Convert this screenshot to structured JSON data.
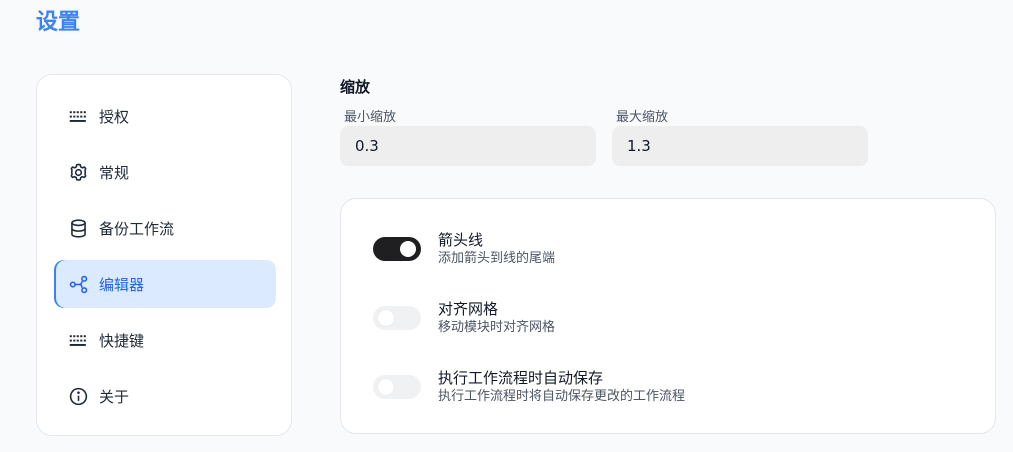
{
  "page": {
    "title": "设置"
  },
  "sidebar": {
    "items": [
      {
        "label": "授权",
        "icon": "keyboard-icon",
        "active": false
      },
      {
        "label": "常规",
        "icon": "gear-icon",
        "active": false
      },
      {
        "label": "备份工作流",
        "icon": "database-icon",
        "active": false
      },
      {
        "label": "编辑器",
        "icon": "share-nodes-icon",
        "active": true
      },
      {
        "label": "快捷键",
        "icon": "keyboard-icon",
        "active": false
      },
      {
        "label": "关于",
        "icon": "info-circle-icon",
        "active": false
      }
    ]
  },
  "zoom": {
    "section_title": "缩放",
    "min": {
      "label": "最小缩放",
      "value": "0.3"
    },
    "max": {
      "label": "最大缩放",
      "value": "1.3"
    }
  },
  "settings": [
    {
      "title": "箭头线",
      "description": "添加箭头到线的尾端",
      "enabled": true
    },
    {
      "title": "对齐网格",
      "description": "移动模块时对齐网格",
      "enabled": false
    },
    {
      "title": "执行工作流程时自动保存",
      "description": "执行工作流程时将自动保存更改的工作流程",
      "enabled": false
    }
  ],
  "colors": {
    "accent": "#3b82f6",
    "active_bg": "#dbeafe",
    "toggle_on": "#1f1f22",
    "toggle_off": "#f0f1f3",
    "input_bg": "#eeeeee"
  }
}
